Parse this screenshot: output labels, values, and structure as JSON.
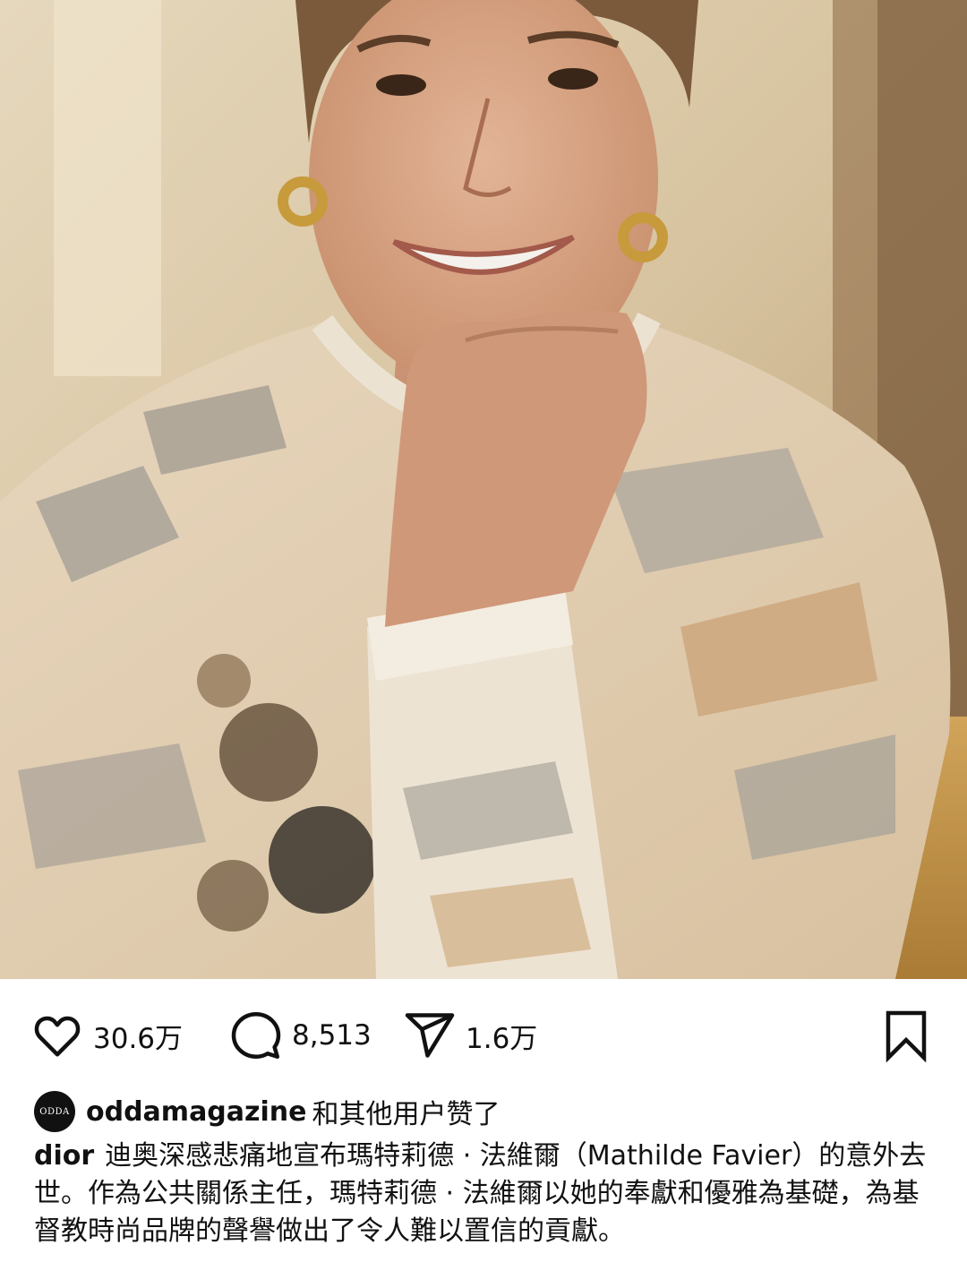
{
  "post": {
    "actions": {
      "like_icon": "heart-icon",
      "like_count": "30.6万",
      "comment_icon": "comment-bubble-icon",
      "comment_count": "8,513",
      "share_icon": "paper-plane-icon",
      "share_count": "1.6万",
      "save_icon": "bookmark-icon"
    },
    "likes": {
      "avatar_text": "ODDA",
      "liker": "oddamagazine",
      "liked_suffix": "和其他用户赞了"
    },
    "caption": {
      "username": "dior",
      "text": "迪奥深感悲痛地宣布瑪特莉德 · 法維爾（Mathilde Favier）的意外去世。作為公共關係主任，瑪特莉德 · 法維爾以她的奉獻和優雅為基礎，為基督教時尚品牌的聲譽做出了令人難以置信的貢獻。"
    },
    "colors": {
      "text": "#111111",
      "background": "#ffffff"
    }
  }
}
